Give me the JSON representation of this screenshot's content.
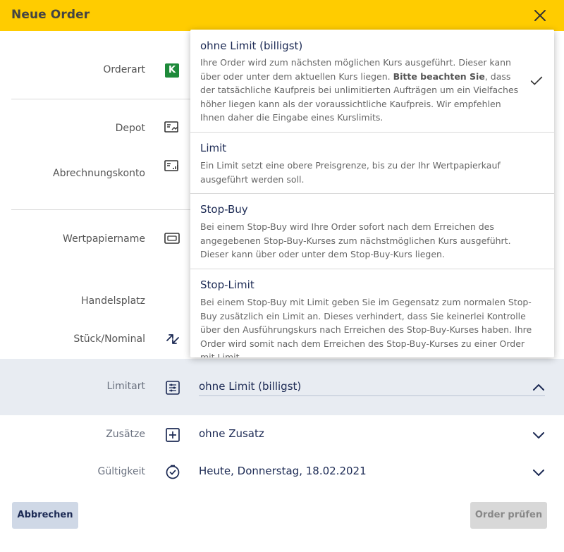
{
  "header": {
    "title": "Neue Order"
  },
  "form": {
    "orderart_label": "Orderart",
    "orderart_badge": "K",
    "depot_label": "Depot",
    "abrechnungskonto_label": "Abrechnungskonto",
    "wertpapiername_label": "Wertpapiername",
    "handelsplatz_label": "Handelsplatz",
    "stueck_label": "Stück/Nominal",
    "limitart_label": "Limitart",
    "limitart_value": "ohne Limit (billigst)",
    "zusaetze_label": "Zusätze",
    "zusaetze_value": "ohne Zusatz",
    "gueltigkeit_label": "Gültigkeit",
    "gueltigkeit_value": "Heute, Donnerstag, 18.02.2021"
  },
  "buttons": {
    "cancel": "Abbrechen",
    "check": "Order prüfen"
  },
  "dropdown": {
    "selected_index": 0,
    "options": [
      {
        "title": "ohne Limit (billigst)",
        "desc_before": "Ihre Order wird zum nächsten möglichen Kurs ausgeführt. Dieser kann über oder unter dem aktuellen Kurs liegen. ",
        "desc_bold": "Bitte beachten Sie",
        "desc_after": ", dass der tatsächliche Kaufpreis bei unlimitierten Aufträgen um ein Vielfaches höher liegen kann als der voraussichtliche Kaufpreis. Wir empfehlen Ihnen daher die Eingabe eines Kurslimits."
      },
      {
        "title": "Limit",
        "desc": "Ein Limit setzt eine obere Preisgrenze, bis zu der Ihr Wertpapierkauf ausgeführt werden soll."
      },
      {
        "title": "Stop-Buy",
        "desc": "Bei einem Stop-Buy wird Ihre Order sofort nach dem Erreichen des angegebenen Stop-Buy-Kurses zum nächstmöglichen Kurs ausgeführt. Dieser kann über oder unter dem Stop-Buy-Kurs liegen."
      },
      {
        "title": "Stop-Limit",
        "desc": "Bei einem Stop-Buy mit Limit geben Sie im Gegensatz zum normalen Stop-Buy zusätzlich ein Limit an. Dieses verhindert, dass Sie keinerlei Kontrolle über den Ausführungskurs nach Erreichen des Stop-Buy-Kurses haben. Ihre Order wird somit nach dem Erreichen des Stop-Buy-Kurses zu einer Order mit Limit."
      }
    ]
  },
  "icons": {
    "close": "close-icon",
    "depot": "depot-icon",
    "account": "account-icon",
    "security": "security-icon",
    "swap": "swap-icon",
    "limit": "sliders-icon",
    "addon": "plus-box-icon",
    "validity": "clock-check-icon",
    "check": "check-icon"
  },
  "colors": {
    "header": "#ffcc00",
    "accent": "#1c2a54",
    "badge": "#1e8a3a",
    "band": "#e8ecf2"
  }
}
